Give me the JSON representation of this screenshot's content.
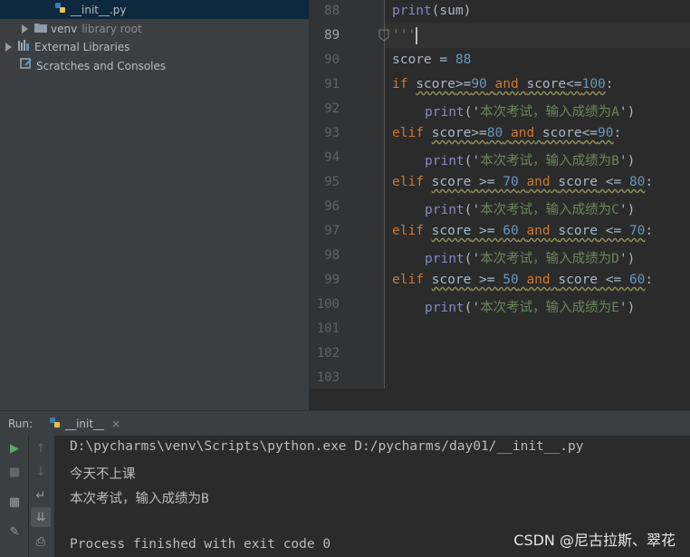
{
  "project_tree": {
    "items": [
      {
        "label": "__init__.py",
        "suffix": ""
      },
      {
        "label": "venv",
        "suffix": "library root"
      },
      {
        "label": "External Libraries",
        "suffix": ""
      },
      {
        "label": "Scratches and Consoles",
        "suffix": ""
      }
    ]
  },
  "editor": {
    "line_numbers": [
      "88",
      "89",
      "90",
      "91",
      "92",
      "93",
      "94",
      "95",
      "96",
      "97",
      "98",
      "99",
      "100",
      "101",
      "102",
      "103"
    ],
    "lines": {
      "l88": {
        "fn": "print",
        "rest": "(sum)"
      },
      "l89": {
        "text": "'''"
      },
      "l90": {
        "text": "score = ",
        "num": "88"
      },
      "l91": {
        "kw1": "if",
        "v1": "score",
        "op1": ">=",
        "n1": "90",
        "kw2": "and",
        "v2": "score",
        "op2": "<=",
        "n2": "100",
        "colon": ":"
      },
      "l92": {
        "fn": "print",
        "open": "('",
        "str": "本次考试，输入成绩为A",
        "close": "')"
      },
      "l93": {
        "kw1": "elif",
        "v1": "score",
        "op1": ">=",
        "n1": "80",
        "kw2": "and",
        "v2": "score",
        "op2": "<=",
        "n2": "90",
        "colon": ":"
      },
      "l94": {
        "fn": "print",
        "open": "('",
        "str": "本次考试，输入成绩为B",
        "close": "')"
      },
      "l95": {
        "kw1": "elif",
        "v1": "score",
        "op1": " >= ",
        "n1": "70",
        "kw2": "and",
        "v2": "score",
        "op2": " <= ",
        "n2": "80",
        "colon": ":"
      },
      "l96": {
        "fn": "print",
        "open": "('",
        "str": "本次考试，输入成绩为C",
        "close": "')"
      },
      "l97": {
        "kw1": "elif",
        "v1": "score",
        "op1": " >= ",
        "n1": "60",
        "kw2": "and",
        "v2": "score",
        "op2": " <= ",
        "n2": "70",
        "colon": ":"
      },
      "l98": {
        "fn": "print",
        "open": "('",
        "str": "本次考试，输入成绩为D",
        "close": "')"
      },
      "l99": {
        "kw1": "elif",
        "v1": "score",
        "op1": " >= ",
        "n1": "50",
        "kw2": "and",
        "v2": "score",
        "op2": " <= ",
        "n2": "60",
        "colon": ":"
      },
      "l100": {
        "fn": "print",
        "open": "('",
        "str": "本次考试，输入成绩为E",
        "close": "')"
      }
    }
  },
  "run_panel": {
    "label": "Run:",
    "tab": "__init__",
    "close": "×",
    "output": [
      "D:\\pycharms\\venv\\Scripts\\python.exe D:/pycharms/day01/__init__.py",
      "今天不上课",
      "本次考试，输入成绩为B",
      "",
      "Process finished with exit code 0"
    ]
  },
  "watermark": "CSDN @尼古拉斯、翠花",
  "colors": {
    "keyword": "#cc7832",
    "number": "#6897bb",
    "string": "#6a8759",
    "builtin": "#8888c6"
  }
}
